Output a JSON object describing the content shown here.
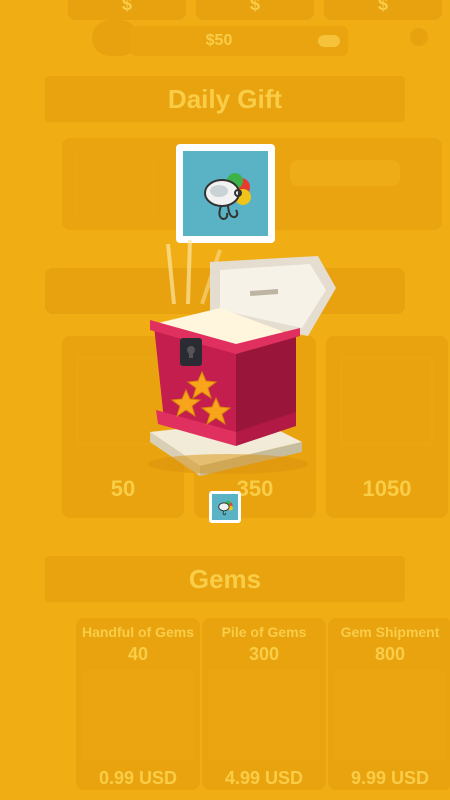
{
  "top_bar": {
    "cards": [
      "$",
      "$",
      "$"
    ],
    "money": "$50"
  },
  "daily_gift": {
    "title": "Daily Gift"
  },
  "offers": {
    "prices": [
      "50",
      "350",
      "1050"
    ]
  },
  "gems": {
    "title": "Gems",
    "packs": [
      {
        "name": "Handful of Gems",
        "amount": "40",
        "price": "0.99 USD"
      },
      {
        "name": "Pile of Gems",
        "amount": "300",
        "price": "4.99 USD"
      },
      {
        "name": "Gem Shipment",
        "amount": "800",
        "price": "9.99 USD"
      }
    ]
  },
  "reward": {
    "item_icon": "fishing-lure-icon",
    "chest_icon": "treasure-chest-icon"
  },
  "colors": {
    "overlay": "#f5b416",
    "chest_red": "#c41e4f",
    "reward_bg": "#5ab3c4"
  }
}
